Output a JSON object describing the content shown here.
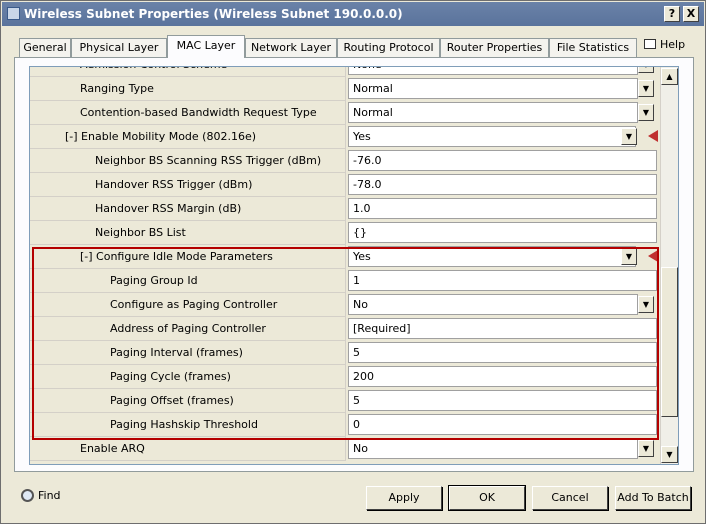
{
  "window": {
    "title": "Wireless Subnet Properties (Wireless Subnet 190.0.0.0)",
    "help_glyph": "?",
    "close_glyph": "X"
  },
  "tabs": [
    {
      "label": "General",
      "active": false
    },
    {
      "label": "Physical Layer",
      "active": false
    },
    {
      "label": "MAC Layer",
      "active": true
    },
    {
      "label": "Network Layer",
      "active": false
    },
    {
      "label": "Routing Protocol",
      "active": false
    },
    {
      "label": "Router Properties",
      "active": false
    },
    {
      "label": "File Statistics",
      "active": false
    }
  ],
  "help_label": "Help",
  "properties": [
    {
      "label": "Admission Control Scheme",
      "value": "None",
      "dropdown": true
    },
    {
      "label": "Ranging Type",
      "value": "Normal",
      "dropdown": true
    },
    {
      "label": "Contention-based Bandwidth Request Type",
      "value": "Normal",
      "dropdown": true
    },
    {
      "label": "[-] Enable Mobility Mode (802.16e)",
      "value": "Yes",
      "dropdown": true,
      "promote": true
    },
    {
      "label": "Neighbor BS Scanning RSS Trigger (dBm)",
      "value": "-76.0",
      "dropdown": false
    },
    {
      "label": "Handover RSS Trigger (dBm)",
      "value": "-78.0",
      "dropdown": false
    },
    {
      "label": "Handover RSS Margin (dB)",
      "value": "1.0",
      "dropdown": false
    },
    {
      "label": "Neighbor BS List",
      "value": "{}",
      "dropdown": false
    },
    {
      "label": "[-] Configure Idle Mode Parameters",
      "value": "Yes",
      "dropdown": true,
      "promote": true
    },
    {
      "label": "Paging Group Id",
      "value": "1",
      "dropdown": false
    },
    {
      "label": "Configure as Paging Controller",
      "value": "No",
      "dropdown": true
    },
    {
      "label": "Address of Paging Controller",
      "value": "[Required]",
      "dropdown": false
    },
    {
      "label": "Paging Interval (frames)",
      "value": "5",
      "dropdown": false
    },
    {
      "label": "Paging Cycle (frames)",
      "value": "200",
      "dropdown": false
    },
    {
      "label": "Paging Offset (frames)",
      "value": "5",
      "dropdown": false
    },
    {
      "label": "Paging Hashskip Threshold",
      "value": "0",
      "dropdown": false
    },
    {
      "label": "Enable ARQ",
      "value": "No",
      "dropdown": true
    }
  ],
  "footer": {
    "find_label": "Find",
    "apply_label": "Apply",
    "ok_label": "OK",
    "cancel_label": "Cancel",
    "add_to_batch_label": "Add To Batch"
  },
  "colors": {
    "highlight_border": "#b40000",
    "titlebar": "#5a739c",
    "promote_icon": "#c03030"
  },
  "icons": {
    "dropdown": "▼",
    "scroll_up": "▲",
    "scroll_down": "▼"
  }
}
